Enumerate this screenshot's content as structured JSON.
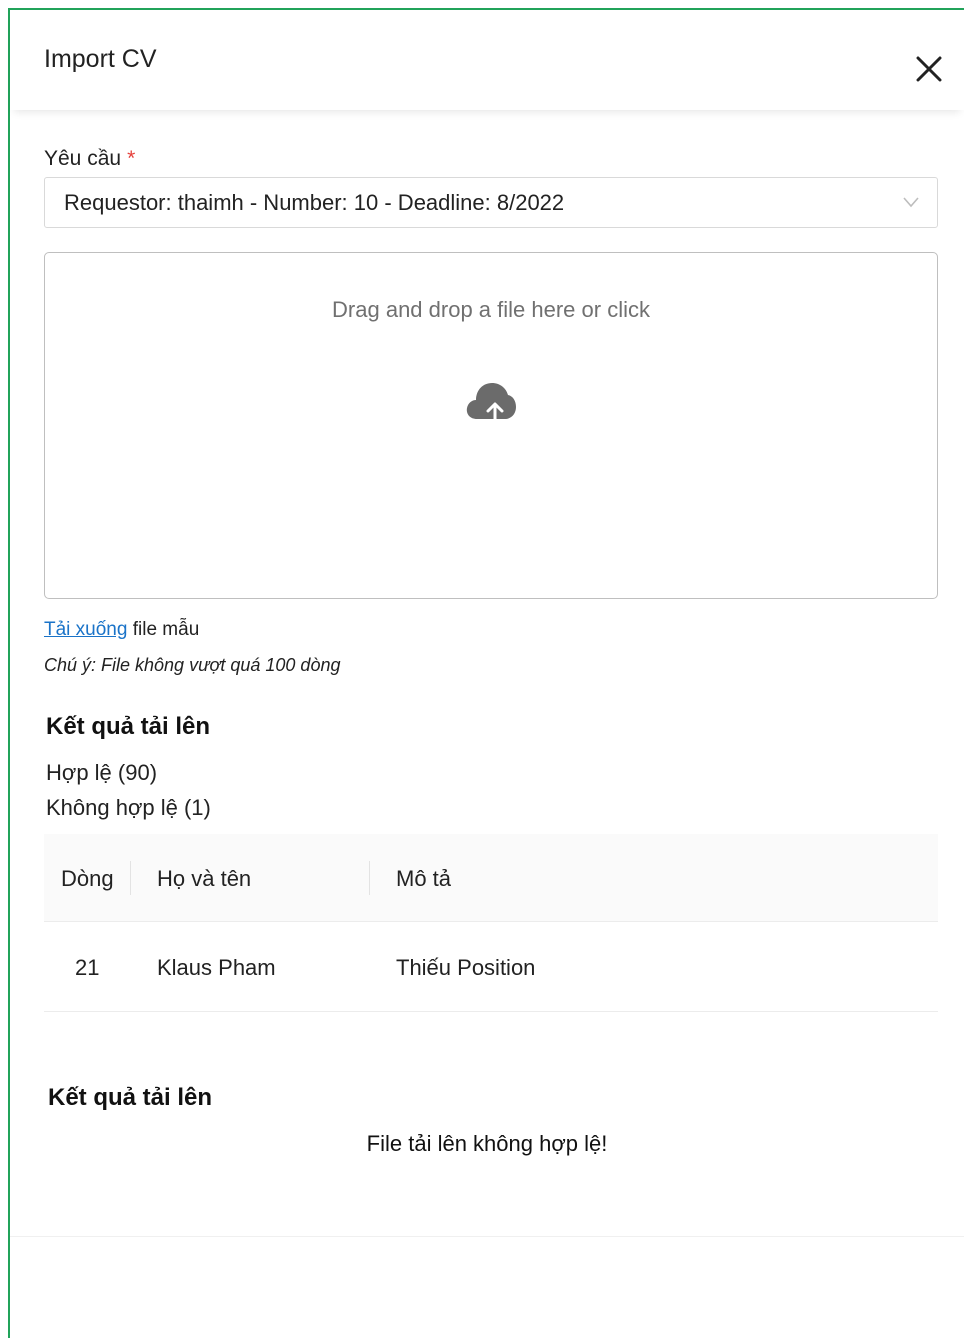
{
  "modal": {
    "title": "Import CV",
    "close_icon": "close-icon"
  },
  "request": {
    "label": "Yêu cầu",
    "required_mark": "*",
    "selected_value": "Requestor: thaimh - Number: 10 - Deadline: 8/2022"
  },
  "dropzone": {
    "message": "Drag and drop a file here or click",
    "icon": "cloud-upload-icon"
  },
  "download": {
    "link_text": "Tải xuống",
    "suffix": " file mẫu"
  },
  "note": "Chú ý: File không vượt quá 100 dòng",
  "results": {
    "title": "Kết quả tải lên",
    "valid": "Hợp lệ (90)",
    "invalid": "Không hợp lệ (1)",
    "table": {
      "headers": [
        "Dòng",
        "Họ và tên",
        "Mô tả"
      ],
      "rows": [
        [
          "21",
          "Klaus Pham",
          "Thiếu Position"
        ]
      ]
    }
  },
  "results2": {
    "title": "Kết quả tải lên",
    "message": "File tải lên không hợp lệ!"
  },
  "colors": {
    "frame_border": "#21a35a",
    "link": "#1a73c8",
    "required": "#e5403b"
  }
}
